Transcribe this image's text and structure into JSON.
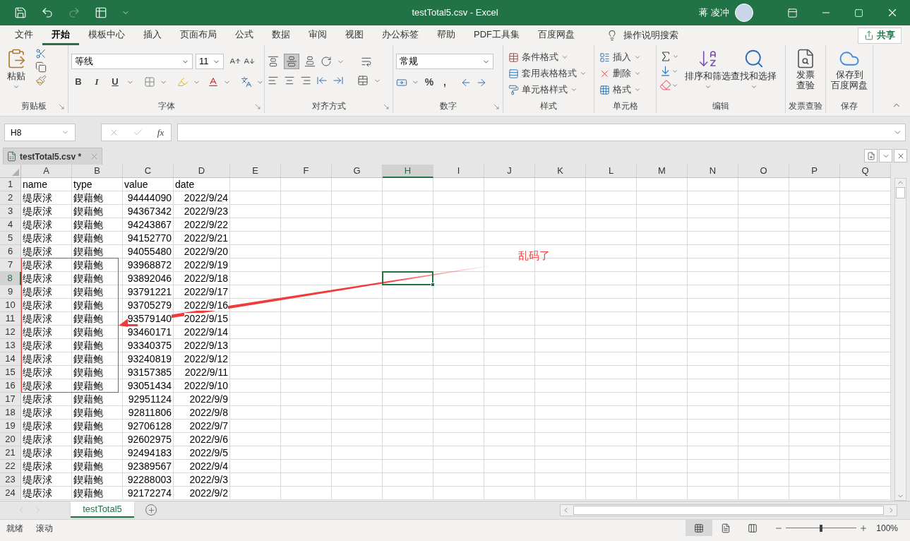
{
  "window": {
    "title": "testTotal5.csv  -  Excel",
    "user": "蒋 凌冲"
  },
  "quick_access": [
    {
      "kind": "save",
      "disabled": false
    },
    {
      "kind": "undo",
      "disabled": false
    },
    {
      "kind": "redo",
      "disabled": true
    },
    {
      "kind": "form",
      "disabled": false
    },
    {
      "kind": "customize",
      "disabled": false
    }
  ],
  "menu_tabs": [
    {
      "label": "文件",
      "selected": false
    },
    {
      "label": "开始",
      "selected": true
    },
    {
      "label": "模板中心",
      "selected": false
    },
    {
      "label": "插入",
      "selected": false
    },
    {
      "label": "页面布局",
      "selected": false
    },
    {
      "label": "公式",
      "selected": false
    },
    {
      "label": "数据",
      "selected": false
    },
    {
      "label": "审阅",
      "selected": false
    },
    {
      "label": "视图",
      "selected": false
    },
    {
      "label": "办公标签",
      "selected": false
    },
    {
      "label": "帮助",
      "selected": false
    },
    {
      "label": "PDF工具集",
      "selected": false
    },
    {
      "label": "百度网盘",
      "selected": false
    }
  ],
  "search_hint": "操作说明搜索",
  "share_button": "共享",
  "ribbon": {
    "clipboard": {
      "paste": "粘贴",
      "label": "剪贴板"
    },
    "font": {
      "font_name": "等线",
      "font_size": "11",
      "format_buttons": [
        "B",
        "I",
        "U"
      ],
      "label": "字体"
    },
    "alignment": {
      "label": "对齐方式"
    },
    "number": {
      "format": "常规",
      "symbols": [
        "%",
        ","
      ],
      "label": "数字"
    },
    "styles": {
      "items": [
        "条件格式",
        "套用表格格式",
        "单元格样式"
      ],
      "label": "样式"
    },
    "cells": {
      "items": [
        "插入",
        "删除",
        "格式"
      ],
      "label": "单元格"
    },
    "editing": {
      "sort": "排序和筛选",
      "find": "查找和选择",
      "label": "编辑"
    },
    "invoice": {
      "button": [
        "发票",
        "查验"
      ],
      "label": "发票查验"
    },
    "save": {
      "button": [
        "保存到",
        "百度网盘"
      ],
      "label": "保存"
    }
  },
  "formula_bar": {
    "name_box": "H8",
    "fx": "fx"
  },
  "workbook_tab": {
    "label": "testTotal5.csv *"
  },
  "sheet": {
    "columns": [
      {
        "label": "A",
        "selected": false
      },
      {
        "label": "B",
        "selected": false
      },
      {
        "label": "C",
        "selected": false
      },
      {
        "label": "D",
        "selected": false
      },
      {
        "label": "E",
        "selected": false
      },
      {
        "label": "F",
        "selected": false
      },
      {
        "label": "G",
        "selected": false
      },
      {
        "label": "H",
        "selected": true
      },
      {
        "label": "I",
        "selected": false
      },
      {
        "label": "J",
        "selected": false
      },
      {
        "label": "K",
        "selected": false
      },
      {
        "label": "L",
        "selected": false
      },
      {
        "label": "M",
        "selected": false
      },
      {
        "label": "N",
        "selected": false
      },
      {
        "label": "O",
        "selected": false
      },
      {
        "label": "P",
        "selected": false
      },
      {
        "label": "Q",
        "selected": false
      }
    ],
    "rows": [
      {
        "number": "1",
        "selected": false,
        "cells": [
          "name",
          "type",
          "value",
          "date"
        ]
      },
      {
        "number": "2",
        "selected": false,
        "cells": [
          "缇庡浗",
          "鍥藉鲍",
          "94444090",
          "2022/9/24"
        ]
      },
      {
        "number": "3",
        "selected": false,
        "cells": [
          "缇庡浗",
          "鍥藉鲍",
          "94367342",
          "2022/9/23"
        ]
      },
      {
        "number": "4",
        "selected": false,
        "cells": [
          "缇庡浗",
          "鍥藉鲍",
          "94243867",
          "2022/9/22"
        ]
      },
      {
        "number": "5",
        "selected": false,
        "cells": [
          "缇庡浗",
          "鍥藉鲍",
          "94152770",
          "2022/9/21"
        ]
      },
      {
        "number": "6",
        "selected": false,
        "cells": [
          "缇庡浗",
          "鍥藉鲍",
          "94055480",
          "2022/9/20"
        ]
      },
      {
        "number": "7",
        "selected": false,
        "cells": [
          "缇庡浗",
          "鍥藉鲍",
          "93968872",
          "2022/9/19"
        ]
      },
      {
        "number": "8",
        "selected": true,
        "cells": [
          "缇庡浗",
          "鍥藉鲍",
          "93892046",
          "2022/9/18"
        ]
      },
      {
        "number": "9",
        "selected": false,
        "cells": [
          "缇庡浗",
          "鍥藉鲍",
          "93791221",
          "2022/9/17"
        ]
      },
      {
        "number": "10",
        "selected": false,
        "cells": [
          "缇庡浗",
          "鍥藉鲍",
          "93705279",
          "2022/9/16"
        ]
      },
      {
        "number": "11",
        "selected": false,
        "cells": [
          "缇庡浗",
          "鍥藉鲍",
          "93579140",
          "2022/9/15"
        ]
      },
      {
        "number": "12",
        "selected": false,
        "cells": [
          "缇庡浗",
          "鍥藉鲍",
          "93460171",
          "2022/9/14"
        ]
      },
      {
        "number": "13",
        "selected": false,
        "cells": [
          "缇庡浗",
          "鍥藉鲍",
          "93340375",
          "2022/9/13"
        ]
      },
      {
        "number": "14",
        "selected": false,
        "cells": [
          "缇庡浗",
          "鍥藉鲍",
          "93240819",
          "2022/9/12"
        ]
      },
      {
        "number": "15",
        "selected": false,
        "cells": [
          "缇庡浗",
          "鍥藉鲍",
          "93157385",
          "2022/9/11"
        ]
      },
      {
        "number": "16",
        "selected": false,
        "cells": [
          "缇庡浗",
          "鍥藉鲍",
          "93051434",
          "2022/9/10"
        ]
      },
      {
        "number": "17",
        "selected": false,
        "cells": [
          "缇庡浗",
          "鍥藉鲍",
          "92951124",
          "2022/9/9"
        ]
      },
      {
        "number": "18",
        "selected": false,
        "cells": [
          "缇庡浗",
          "鍥藉鲍",
          "92811806",
          "2022/9/8"
        ]
      },
      {
        "number": "19",
        "selected": false,
        "cells": [
          "缇庡浗",
          "鍥藉鲍",
          "92706128",
          "2022/9/7"
        ]
      },
      {
        "number": "20",
        "selected": false,
        "cells": [
          "缇庡浗",
          "鍥藉鲍",
          "92602975",
          "2022/9/6"
        ]
      },
      {
        "number": "21",
        "selected": false,
        "cells": [
          "缇庡浗",
          "鍥藉鲍",
          "92494183",
          "2022/9/5"
        ]
      },
      {
        "number": "22",
        "selected": false,
        "cells": [
          "缇庡浗",
          "鍥藉鲍",
          "92389567",
          "2022/9/4"
        ]
      },
      {
        "number": "23",
        "selected": false,
        "cells": [
          "缇庡浗",
          "鍥藉鲍",
          "92288003",
          "2022/9/3"
        ]
      },
      {
        "number": "24",
        "selected": false,
        "cells": [
          "缇庡浗",
          "鍥藉鲍",
          "92172274",
          "2022/9/2"
        ]
      }
    ]
  },
  "annotation": {
    "text": "乱码了"
  },
  "sheet_tabs": [
    {
      "label": "testTotal5",
      "selected": true
    }
  ],
  "status_bar": {
    "items": [
      "就绪",
      "滚动"
    ],
    "zoom": {
      "label": "100%",
      "level": 0.5
    }
  }
}
